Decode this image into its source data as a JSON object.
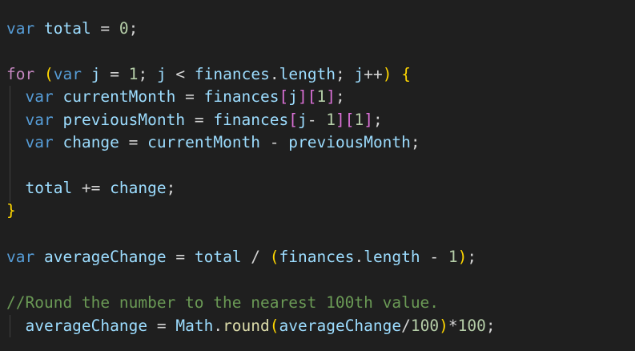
{
  "colors": {
    "background": "#1f1f1f",
    "keyword": "#569cd6",
    "control_keyword": "#c586c0",
    "variable": "#9cdcfe",
    "number": "#b5cea8",
    "function": "#dcdcaa",
    "comment": "#6a9955",
    "bracket_level_1": "#ffd700",
    "bracket_level_2": "#da70d6",
    "bracket_level_3": "#179fff",
    "plain": "#d4d4d4"
  },
  "code": {
    "lines": [
      [
        {
          "t": "var",
          "c": "kw"
        },
        {
          "t": " ",
          "c": "plain"
        },
        {
          "t": "total",
          "c": "var"
        },
        {
          "t": " = ",
          "c": "op"
        },
        {
          "t": "0",
          "c": "num"
        },
        {
          "t": ";",
          "c": "plain"
        }
      ],
      [],
      [
        {
          "t": "for",
          "c": "kw-ctrl"
        },
        {
          "t": " ",
          "c": "plain"
        },
        {
          "t": "(",
          "c": "b1"
        },
        {
          "t": "var",
          "c": "kw"
        },
        {
          "t": " ",
          "c": "plain"
        },
        {
          "t": "j",
          "c": "var"
        },
        {
          "t": " = ",
          "c": "op"
        },
        {
          "t": "1",
          "c": "num"
        },
        {
          "t": "; ",
          "c": "plain"
        },
        {
          "t": "j",
          "c": "var"
        },
        {
          "t": " < ",
          "c": "op"
        },
        {
          "t": "finances",
          "c": "var"
        },
        {
          "t": ".",
          "c": "plain"
        },
        {
          "t": "length",
          "c": "var"
        },
        {
          "t": "; ",
          "c": "plain"
        },
        {
          "t": "j",
          "c": "var"
        },
        {
          "t": "++",
          "c": "op"
        },
        {
          "t": ")",
          "c": "b1"
        },
        {
          "t": " ",
          "c": "plain"
        },
        {
          "t": "{",
          "c": "b1"
        }
      ],
      [
        {
          "t": "  ",
          "c": "plain"
        },
        {
          "t": "var",
          "c": "kw"
        },
        {
          "t": " ",
          "c": "plain"
        },
        {
          "t": "currentMonth",
          "c": "var"
        },
        {
          "t": " = ",
          "c": "op"
        },
        {
          "t": "finances",
          "c": "var"
        },
        {
          "t": "[",
          "c": "b2"
        },
        {
          "t": "j",
          "c": "var"
        },
        {
          "t": "]",
          "c": "b2"
        },
        {
          "t": "[",
          "c": "b2"
        },
        {
          "t": "1",
          "c": "num"
        },
        {
          "t": "]",
          "c": "b2"
        },
        {
          "t": ";",
          "c": "plain"
        }
      ],
      [
        {
          "t": "  ",
          "c": "plain"
        },
        {
          "t": "var",
          "c": "kw"
        },
        {
          "t": " ",
          "c": "plain"
        },
        {
          "t": "previousMonth",
          "c": "var"
        },
        {
          "t": " = ",
          "c": "op"
        },
        {
          "t": "finances",
          "c": "var"
        },
        {
          "t": "[",
          "c": "b2"
        },
        {
          "t": "j",
          "c": "var"
        },
        {
          "t": "- ",
          "c": "op"
        },
        {
          "t": "1",
          "c": "num"
        },
        {
          "t": "]",
          "c": "b2"
        },
        {
          "t": "[",
          "c": "b2"
        },
        {
          "t": "1",
          "c": "num"
        },
        {
          "t": "]",
          "c": "b2"
        },
        {
          "t": ";",
          "c": "plain"
        }
      ],
      [
        {
          "t": "  ",
          "c": "plain"
        },
        {
          "t": "var",
          "c": "kw"
        },
        {
          "t": " ",
          "c": "plain"
        },
        {
          "t": "change",
          "c": "var"
        },
        {
          "t": " = ",
          "c": "op"
        },
        {
          "t": "currentMonth",
          "c": "var"
        },
        {
          "t": " - ",
          "c": "op"
        },
        {
          "t": "previousMonth",
          "c": "var"
        },
        {
          "t": ";",
          "c": "plain"
        }
      ],
      [],
      [
        {
          "t": "  ",
          "c": "plain"
        },
        {
          "t": "total",
          "c": "var"
        },
        {
          "t": " += ",
          "c": "op"
        },
        {
          "t": "change",
          "c": "var"
        },
        {
          "t": ";",
          "c": "plain"
        }
      ],
      [
        {
          "t": "}",
          "c": "b1"
        }
      ],
      [],
      [
        {
          "t": "var",
          "c": "kw"
        },
        {
          "t": " ",
          "c": "plain"
        },
        {
          "t": "averageChange",
          "c": "var"
        },
        {
          "t": " = ",
          "c": "op"
        },
        {
          "t": "total",
          "c": "var"
        },
        {
          "t": " / ",
          "c": "op"
        },
        {
          "t": "(",
          "c": "b1"
        },
        {
          "t": "finances",
          "c": "var"
        },
        {
          "t": ".",
          "c": "plain"
        },
        {
          "t": "length",
          "c": "var"
        },
        {
          "t": " - ",
          "c": "op"
        },
        {
          "t": "1",
          "c": "num"
        },
        {
          "t": ")",
          "c": "b1"
        },
        {
          "t": ";",
          "c": "plain"
        }
      ],
      [],
      [
        {
          "t": "//Round the number to the nearest 100th value.",
          "c": "comment"
        }
      ],
      [
        {
          "t": "  ",
          "c": "plain"
        },
        {
          "t": "averageChange",
          "c": "var"
        },
        {
          "t": " = ",
          "c": "op"
        },
        {
          "t": "Math",
          "c": "var"
        },
        {
          "t": ".",
          "c": "plain"
        },
        {
          "t": "round",
          "c": "fn"
        },
        {
          "t": "(",
          "c": "b1"
        },
        {
          "t": "averageChange",
          "c": "var"
        },
        {
          "t": "/",
          "c": "op"
        },
        {
          "t": "100",
          "c": "num"
        },
        {
          "t": ")",
          "c": "b1"
        },
        {
          "t": "*",
          "c": "op"
        },
        {
          "t": "100",
          "c": "num"
        },
        {
          "t": ";",
          "c": "plain"
        }
      ]
    ]
  }
}
